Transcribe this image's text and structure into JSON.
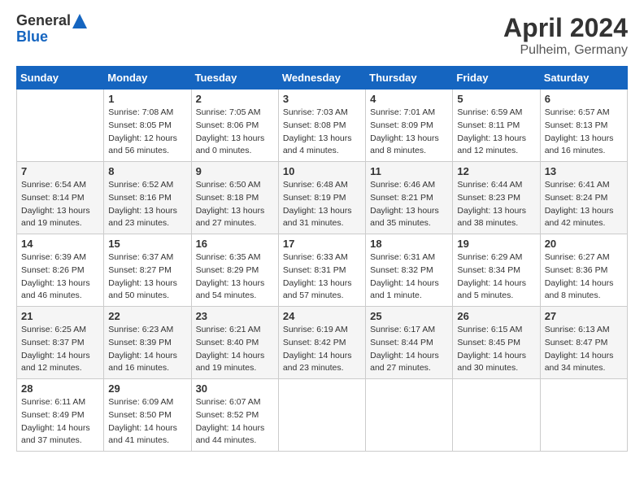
{
  "header": {
    "logo_general": "General",
    "logo_blue": "Blue",
    "title": "April 2024",
    "subtitle": "Pulheim, Germany"
  },
  "days_of_week": [
    "Sunday",
    "Monday",
    "Tuesday",
    "Wednesday",
    "Thursday",
    "Friday",
    "Saturday"
  ],
  "weeks": [
    [
      {
        "day": "",
        "sunrise": "",
        "sunset": "",
        "daylight": ""
      },
      {
        "day": "1",
        "sunrise": "Sunrise: 7:08 AM",
        "sunset": "Sunset: 8:05 PM",
        "daylight": "Daylight: 12 hours and 56 minutes."
      },
      {
        "day": "2",
        "sunrise": "Sunrise: 7:05 AM",
        "sunset": "Sunset: 8:06 PM",
        "daylight": "Daylight: 13 hours and 0 minutes."
      },
      {
        "day": "3",
        "sunrise": "Sunrise: 7:03 AM",
        "sunset": "Sunset: 8:08 PM",
        "daylight": "Daylight: 13 hours and 4 minutes."
      },
      {
        "day": "4",
        "sunrise": "Sunrise: 7:01 AM",
        "sunset": "Sunset: 8:09 PM",
        "daylight": "Daylight: 13 hours and 8 minutes."
      },
      {
        "day": "5",
        "sunrise": "Sunrise: 6:59 AM",
        "sunset": "Sunset: 8:11 PM",
        "daylight": "Daylight: 13 hours and 12 minutes."
      },
      {
        "day": "6",
        "sunrise": "Sunrise: 6:57 AM",
        "sunset": "Sunset: 8:13 PM",
        "daylight": "Daylight: 13 hours and 16 minutes."
      }
    ],
    [
      {
        "day": "7",
        "sunrise": "Sunrise: 6:54 AM",
        "sunset": "Sunset: 8:14 PM",
        "daylight": "Daylight: 13 hours and 19 minutes."
      },
      {
        "day": "8",
        "sunrise": "Sunrise: 6:52 AM",
        "sunset": "Sunset: 8:16 PM",
        "daylight": "Daylight: 13 hours and 23 minutes."
      },
      {
        "day": "9",
        "sunrise": "Sunrise: 6:50 AM",
        "sunset": "Sunset: 8:18 PM",
        "daylight": "Daylight: 13 hours and 27 minutes."
      },
      {
        "day": "10",
        "sunrise": "Sunrise: 6:48 AM",
        "sunset": "Sunset: 8:19 PM",
        "daylight": "Daylight: 13 hours and 31 minutes."
      },
      {
        "day": "11",
        "sunrise": "Sunrise: 6:46 AM",
        "sunset": "Sunset: 8:21 PM",
        "daylight": "Daylight: 13 hours and 35 minutes."
      },
      {
        "day": "12",
        "sunrise": "Sunrise: 6:44 AM",
        "sunset": "Sunset: 8:23 PM",
        "daylight": "Daylight: 13 hours and 38 minutes."
      },
      {
        "day": "13",
        "sunrise": "Sunrise: 6:41 AM",
        "sunset": "Sunset: 8:24 PM",
        "daylight": "Daylight: 13 hours and 42 minutes."
      }
    ],
    [
      {
        "day": "14",
        "sunrise": "Sunrise: 6:39 AM",
        "sunset": "Sunset: 8:26 PM",
        "daylight": "Daylight: 13 hours and 46 minutes."
      },
      {
        "day": "15",
        "sunrise": "Sunrise: 6:37 AM",
        "sunset": "Sunset: 8:27 PM",
        "daylight": "Daylight: 13 hours and 50 minutes."
      },
      {
        "day": "16",
        "sunrise": "Sunrise: 6:35 AM",
        "sunset": "Sunset: 8:29 PM",
        "daylight": "Daylight: 13 hours and 54 minutes."
      },
      {
        "day": "17",
        "sunrise": "Sunrise: 6:33 AM",
        "sunset": "Sunset: 8:31 PM",
        "daylight": "Daylight: 13 hours and 57 minutes."
      },
      {
        "day": "18",
        "sunrise": "Sunrise: 6:31 AM",
        "sunset": "Sunset: 8:32 PM",
        "daylight": "Daylight: 14 hours and 1 minute."
      },
      {
        "day": "19",
        "sunrise": "Sunrise: 6:29 AM",
        "sunset": "Sunset: 8:34 PM",
        "daylight": "Daylight: 14 hours and 5 minutes."
      },
      {
        "day": "20",
        "sunrise": "Sunrise: 6:27 AM",
        "sunset": "Sunset: 8:36 PM",
        "daylight": "Daylight: 14 hours and 8 minutes."
      }
    ],
    [
      {
        "day": "21",
        "sunrise": "Sunrise: 6:25 AM",
        "sunset": "Sunset: 8:37 PM",
        "daylight": "Daylight: 14 hours and 12 minutes."
      },
      {
        "day": "22",
        "sunrise": "Sunrise: 6:23 AM",
        "sunset": "Sunset: 8:39 PM",
        "daylight": "Daylight: 14 hours and 16 minutes."
      },
      {
        "day": "23",
        "sunrise": "Sunrise: 6:21 AM",
        "sunset": "Sunset: 8:40 PM",
        "daylight": "Daylight: 14 hours and 19 minutes."
      },
      {
        "day": "24",
        "sunrise": "Sunrise: 6:19 AM",
        "sunset": "Sunset: 8:42 PM",
        "daylight": "Daylight: 14 hours and 23 minutes."
      },
      {
        "day": "25",
        "sunrise": "Sunrise: 6:17 AM",
        "sunset": "Sunset: 8:44 PM",
        "daylight": "Daylight: 14 hours and 27 minutes."
      },
      {
        "day": "26",
        "sunrise": "Sunrise: 6:15 AM",
        "sunset": "Sunset: 8:45 PM",
        "daylight": "Daylight: 14 hours and 30 minutes."
      },
      {
        "day": "27",
        "sunrise": "Sunrise: 6:13 AM",
        "sunset": "Sunset: 8:47 PM",
        "daylight": "Daylight: 14 hours and 34 minutes."
      }
    ],
    [
      {
        "day": "28",
        "sunrise": "Sunrise: 6:11 AM",
        "sunset": "Sunset: 8:49 PM",
        "daylight": "Daylight: 14 hours and 37 minutes."
      },
      {
        "day": "29",
        "sunrise": "Sunrise: 6:09 AM",
        "sunset": "Sunset: 8:50 PM",
        "daylight": "Daylight: 14 hours and 41 minutes."
      },
      {
        "day": "30",
        "sunrise": "Sunrise: 6:07 AM",
        "sunset": "Sunset: 8:52 PM",
        "daylight": "Daylight: 14 hours and 44 minutes."
      },
      {
        "day": "",
        "sunrise": "",
        "sunset": "",
        "daylight": ""
      },
      {
        "day": "",
        "sunrise": "",
        "sunset": "",
        "daylight": ""
      },
      {
        "day": "",
        "sunrise": "",
        "sunset": "",
        "daylight": ""
      },
      {
        "day": "",
        "sunrise": "",
        "sunset": "",
        "daylight": ""
      }
    ]
  ]
}
